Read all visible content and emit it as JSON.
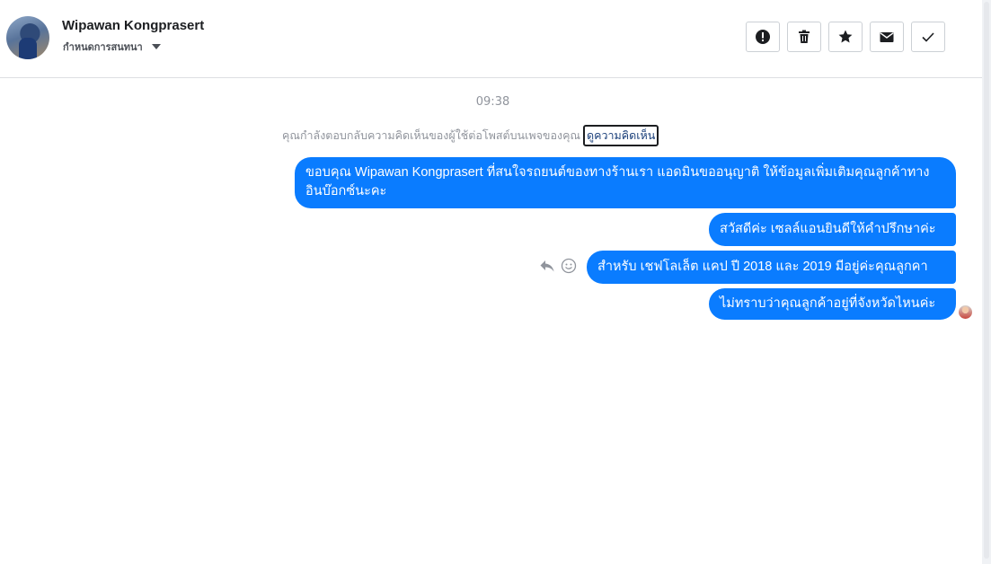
{
  "header": {
    "name": "Wipawan Kongprasert",
    "subtitle": "กำหนดการสนทนา",
    "actions": [
      {
        "icon": "alert-icon",
        "label": "report"
      },
      {
        "icon": "trash-icon",
        "label": "delete"
      },
      {
        "icon": "star-icon",
        "label": "star"
      },
      {
        "icon": "envelope-icon",
        "label": "mark-unread"
      },
      {
        "icon": "checkmark-icon",
        "label": "done"
      }
    ]
  },
  "conversation": {
    "timestamp": "09:38",
    "notice_text": "คุณกำลังตอบกลับความคิดเห็นของผู้ใช้ต่อโพสต์บนเพจของคุณ",
    "notice_link": "ดูความคิดเห็น",
    "messages": [
      {
        "text": "ขอบคุณ Wipawan Kongprasert ที่สนใจรถยนต์ของทางร้านเรา แอดมินขออนุญาติ ให้ข้อมูลเพิ่มเติมคุณลูกค้าทางอินบ๊อกซ์นะคะ"
      },
      {
        "text": "สวัสดีค่ะ เซลล์แอนยินดีให้คำปรึกษาค่ะ"
      },
      {
        "text": "สำหรับ เชฟโลเล็ต แคป ปี 2018 และ 2019 มีอยู่ค่ะคุณลูกคา"
      },
      {
        "text": "ไม่ทราบว่าคุณลูกค้าอยู่ที่จังหวัดไหนค่ะ"
      }
    ]
  },
  "colors": {
    "bubble": "#0a7cff",
    "muted_text": "#90949c",
    "border": "#ccd0d5"
  }
}
